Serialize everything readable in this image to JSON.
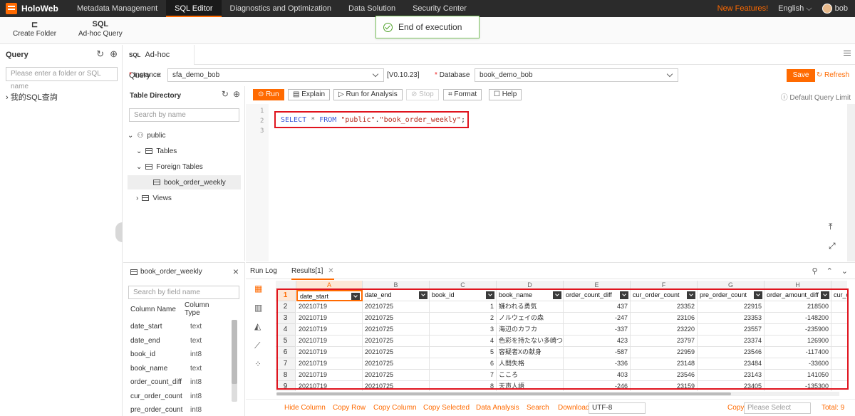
{
  "app": {
    "logo": "HoloWeb",
    "new_features": "New Features!",
    "language": "English",
    "user": "bob"
  },
  "nav": [
    "Metadata Management",
    "SQL Editor",
    "Diagnostics and Optimization",
    "Data Solution",
    "Security Center"
  ],
  "toolbar": {
    "create_folder": "Create Folder",
    "adhoc_icon": "SQL",
    "adhoc": "Ad-hoc Query"
  },
  "toast": "End of execution",
  "left": {
    "title": "Query",
    "search_placeholder": "Please enter a folder or SQL name",
    "item": "我的SQL查詢"
  },
  "tab": {
    "icon": "SQL",
    "label": "Ad-hoc Query"
  },
  "instance": {
    "label": "Instance",
    "value": "sfa_demo_bob",
    "version": "[V0.10.23]"
  },
  "database": {
    "label": "Database",
    "value": "book_demo_bob"
  },
  "actions": {
    "save": "Save",
    "refresh": "Refresh"
  },
  "table_dir": {
    "title": "Table Directory",
    "search_placeholder": "Search by name",
    "schema": "public",
    "tables": "Tables",
    "foreign": "Foreign Tables",
    "table": "book_order_weekly",
    "views": "Views"
  },
  "editor_toolbar": {
    "run": "Run",
    "explain": "Explain",
    "run_analysis": "Run for Analysis",
    "stop": "Stop",
    "format": "Format",
    "help": "Help",
    "default_limit": "Default Query Limit"
  },
  "editor": {
    "lines": [
      "1",
      "2",
      "3"
    ]
  },
  "columns_panel": {
    "title": "book_order_weekly",
    "search_placeholder": "Search by field name",
    "col_name": "Column Name",
    "col_type": "Column Type",
    "rows": [
      [
        "date_start",
        "text"
      ],
      [
        "date_end",
        "text"
      ],
      [
        "book_id",
        "int8"
      ],
      [
        "book_name",
        "text"
      ],
      [
        "order_count_diff",
        "int8"
      ],
      [
        "cur_order_count",
        "int8"
      ],
      [
        "pre_order_count",
        "int8"
      ]
    ]
  },
  "results": {
    "run_log": "Run Log",
    "tab": "Results[1]",
    "letters": [
      "A",
      "B",
      "C",
      "D",
      "E",
      "F",
      "G",
      "H"
    ],
    "headers": [
      "date_start",
      "date_end",
      "book_id",
      "book_name",
      "order_count_diff",
      "cur_order_count",
      "pre_order_count",
      "order_amount_diff",
      "cur_o"
    ],
    "row_numbers": [
      "1",
      "2",
      "3",
      "4",
      "5",
      "6",
      "7",
      "8",
      "9"
    ],
    "rows": [
      [
        "20210719",
        "20210725",
        "1",
        "嫌われる勇気",
        "437",
        "23352",
        "22915",
        "218500"
      ],
      [
        "20210719",
        "20210725",
        "2",
        "ノルウェイの森",
        "-247",
        "23106",
        "23353",
        "-148200"
      ],
      [
        "20210719",
        "20210725",
        "3",
        "海辺のカフカ",
        "-337",
        "23220",
        "23557",
        "-235900"
      ],
      [
        "20210719",
        "20210725",
        "4",
        "色彩を持たない多崎つ",
        "423",
        "23797",
        "23374",
        "126900"
      ],
      [
        "20210719",
        "20210725",
        "5",
        "容疑者Xの献身",
        "-587",
        "22959",
        "23546",
        "-117400"
      ],
      [
        "20210719",
        "20210725",
        "6",
        "人間失格",
        "-336",
        "23148",
        "23484",
        "-33600"
      ],
      [
        "20210719",
        "20210725",
        "7",
        "こころ",
        "403",
        "23546",
        "23143",
        "141050"
      ],
      [
        "20210719",
        "20210725",
        "8",
        "天声人語",
        "-246",
        "23159",
        "23405",
        "-135300"
      ]
    ]
  },
  "footer": {
    "hide_column": "Hide Column",
    "copy_row": "Copy Row",
    "copy_column": "Copy Column",
    "copy_selected": "Copy Selected",
    "data_analysis": "Data Analysis",
    "search": "Search",
    "download": "Download",
    "encoding": "UTF-8",
    "copy": "Copy",
    "copy_placeholder": "Please Select",
    "total": "Total: 9"
  }
}
